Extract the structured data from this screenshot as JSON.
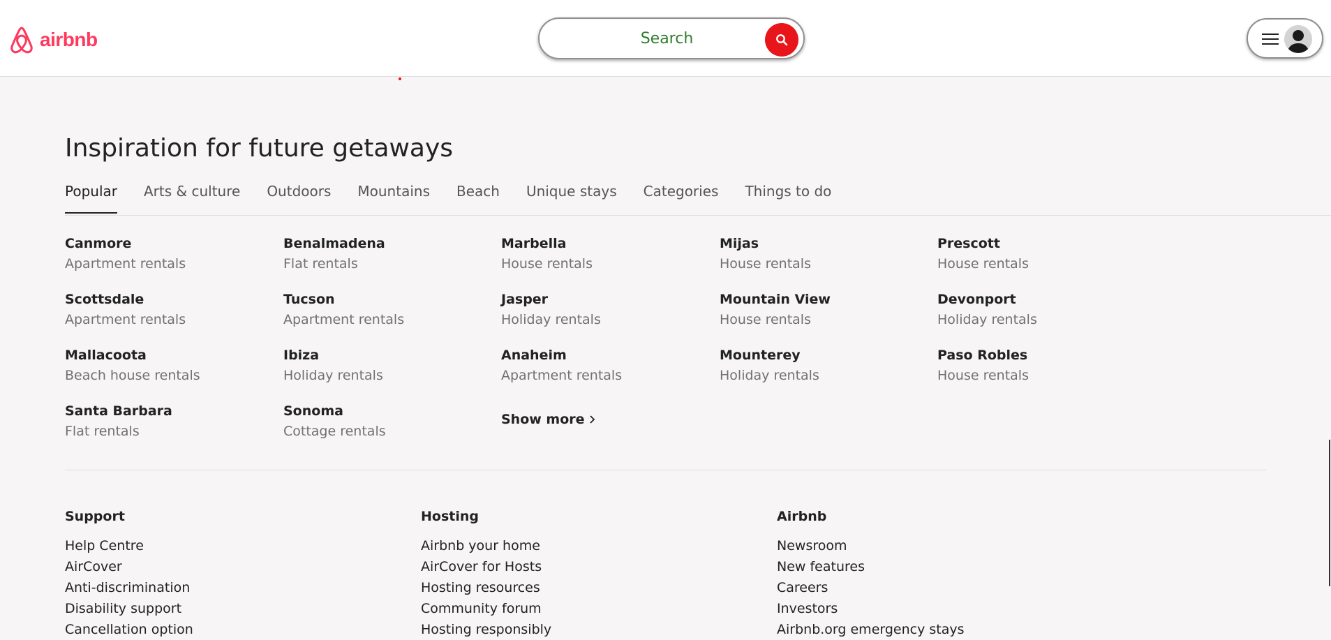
{
  "header": {
    "logo_text": "airbnb",
    "logo_icon": "airbnb-belo-icon",
    "search_label": "Search",
    "search_icon": "search-icon",
    "menu_icon": "hamburger-icon",
    "avatar_icon": "user-avatar-icon"
  },
  "colors": {
    "brand": "#ff385c",
    "search_button": "#e8151b",
    "search_text": "#2d7d2d"
  },
  "main": {
    "title": "Inspiration for future getaways",
    "tabs": [
      {
        "label": "Popular",
        "active": true
      },
      {
        "label": "Arts & culture",
        "active": false
      },
      {
        "label": "Outdoors",
        "active": false
      },
      {
        "label": "Mountains",
        "active": false
      },
      {
        "label": "Beach",
        "active": false
      },
      {
        "label": "Unique stays",
        "active": false
      },
      {
        "label": "Categories",
        "active": false
      },
      {
        "label": "Things to do",
        "active": false
      }
    ],
    "destinations": [
      {
        "city": "Canmore",
        "type": "Apartment rentals"
      },
      {
        "city": "Benalmadena",
        "type": "Flat rentals"
      },
      {
        "city": "Marbella",
        "type": "House rentals"
      },
      {
        "city": "Mijas",
        "type": "House rentals"
      },
      {
        "city": "Prescott",
        "type": "House rentals"
      },
      {
        "city": "Scottsdale",
        "type": "Apartment rentals"
      },
      {
        "city": "Tucson",
        "type": "Apartment rentals"
      },
      {
        "city": "Jasper",
        "type": "Holiday rentals"
      },
      {
        "city": "Mountain View",
        "type": "House rentals"
      },
      {
        "city": "Devonport",
        "type": "Holiday rentals"
      },
      {
        "city": "Mallacoota",
        "type": "Beach house rentals"
      },
      {
        "city": "Ibiza",
        "type": "Holiday rentals"
      },
      {
        "city": "Anaheim",
        "type": "Apartment rentals"
      },
      {
        "city": "Mounterey",
        "type": "Holiday rentals"
      },
      {
        "city": "Paso Robles",
        "type": "House rentals"
      },
      {
        "city": "Santa Barbara",
        "type": "Flat rentals"
      },
      {
        "city": "Sonoma",
        "type": "Cottage rentals"
      }
    ],
    "show_more": "Show more"
  },
  "footer": {
    "columns": [
      {
        "heading": "Support",
        "links": [
          "Help Centre",
          "AirCover",
          "Anti-discrimination",
          "Disability support",
          "Cancellation option"
        ]
      },
      {
        "heading": "Hosting",
        "links": [
          "Airbnb your home",
          "AirCover for Hosts",
          "Hosting resources",
          "Community forum",
          "Hosting responsibly"
        ]
      },
      {
        "heading": "Airbnb",
        "links": [
          "Newsroom",
          "New features",
          "Careers",
          "Investors",
          "Airbnb.org emergency stays"
        ]
      }
    ]
  }
}
